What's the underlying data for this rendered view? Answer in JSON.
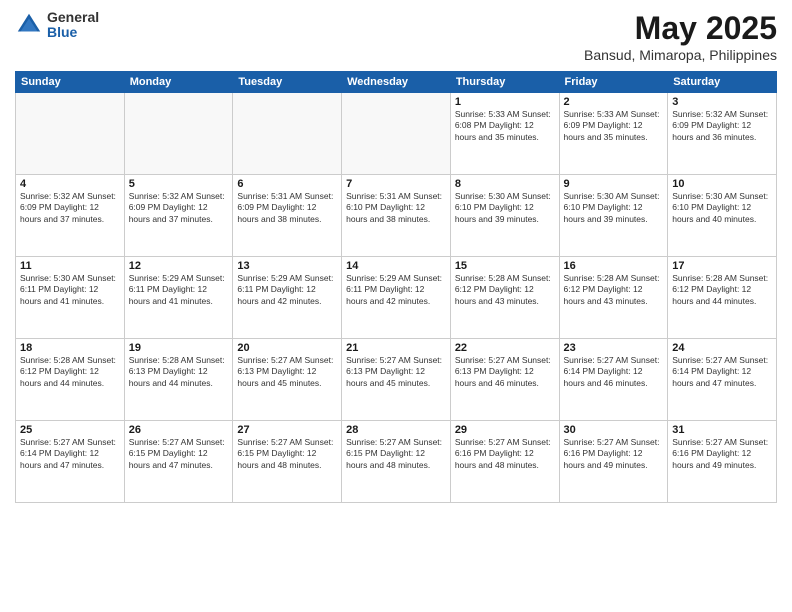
{
  "header": {
    "logo_general": "General",
    "logo_blue": "Blue",
    "title": "May 2025",
    "subtitle": "Bansud, Mimaropa, Philippines"
  },
  "days_of_week": [
    "Sunday",
    "Monday",
    "Tuesday",
    "Wednesday",
    "Thursday",
    "Friday",
    "Saturday"
  ],
  "weeks": [
    [
      {
        "day": "",
        "info": ""
      },
      {
        "day": "",
        "info": ""
      },
      {
        "day": "",
        "info": ""
      },
      {
        "day": "",
        "info": ""
      },
      {
        "day": "1",
        "info": "Sunrise: 5:33 AM\nSunset: 6:08 PM\nDaylight: 12 hours\nand 35 minutes."
      },
      {
        "day": "2",
        "info": "Sunrise: 5:33 AM\nSunset: 6:09 PM\nDaylight: 12 hours\nand 35 minutes."
      },
      {
        "day": "3",
        "info": "Sunrise: 5:32 AM\nSunset: 6:09 PM\nDaylight: 12 hours\nand 36 minutes."
      }
    ],
    [
      {
        "day": "4",
        "info": "Sunrise: 5:32 AM\nSunset: 6:09 PM\nDaylight: 12 hours\nand 37 minutes."
      },
      {
        "day": "5",
        "info": "Sunrise: 5:32 AM\nSunset: 6:09 PM\nDaylight: 12 hours\nand 37 minutes."
      },
      {
        "day": "6",
        "info": "Sunrise: 5:31 AM\nSunset: 6:09 PM\nDaylight: 12 hours\nand 38 minutes."
      },
      {
        "day": "7",
        "info": "Sunrise: 5:31 AM\nSunset: 6:10 PM\nDaylight: 12 hours\nand 38 minutes."
      },
      {
        "day": "8",
        "info": "Sunrise: 5:30 AM\nSunset: 6:10 PM\nDaylight: 12 hours\nand 39 minutes."
      },
      {
        "day": "9",
        "info": "Sunrise: 5:30 AM\nSunset: 6:10 PM\nDaylight: 12 hours\nand 39 minutes."
      },
      {
        "day": "10",
        "info": "Sunrise: 5:30 AM\nSunset: 6:10 PM\nDaylight: 12 hours\nand 40 minutes."
      }
    ],
    [
      {
        "day": "11",
        "info": "Sunrise: 5:30 AM\nSunset: 6:11 PM\nDaylight: 12 hours\nand 41 minutes."
      },
      {
        "day": "12",
        "info": "Sunrise: 5:29 AM\nSunset: 6:11 PM\nDaylight: 12 hours\nand 41 minutes."
      },
      {
        "day": "13",
        "info": "Sunrise: 5:29 AM\nSunset: 6:11 PM\nDaylight: 12 hours\nand 42 minutes."
      },
      {
        "day": "14",
        "info": "Sunrise: 5:29 AM\nSunset: 6:11 PM\nDaylight: 12 hours\nand 42 minutes."
      },
      {
        "day": "15",
        "info": "Sunrise: 5:28 AM\nSunset: 6:12 PM\nDaylight: 12 hours\nand 43 minutes."
      },
      {
        "day": "16",
        "info": "Sunrise: 5:28 AM\nSunset: 6:12 PM\nDaylight: 12 hours\nand 43 minutes."
      },
      {
        "day": "17",
        "info": "Sunrise: 5:28 AM\nSunset: 6:12 PM\nDaylight: 12 hours\nand 44 minutes."
      }
    ],
    [
      {
        "day": "18",
        "info": "Sunrise: 5:28 AM\nSunset: 6:12 PM\nDaylight: 12 hours\nand 44 minutes."
      },
      {
        "day": "19",
        "info": "Sunrise: 5:28 AM\nSunset: 6:13 PM\nDaylight: 12 hours\nand 44 minutes."
      },
      {
        "day": "20",
        "info": "Sunrise: 5:27 AM\nSunset: 6:13 PM\nDaylight: 12 hours\nand 45 minutes."
      },
      {
        "day": "21",
        "info": "Sunrise: 5:27 AM\nSunset: 6:13 PM\nDaylight: 12 hours\nand 45 minutes."
      },
      {
        "day": "22",
        "info": "Sunrise: 5:27 AM\nSunset: 6:13 PM\nDaylight: 12 hours\nand 46 minutes."
      },
      {
        "day": "23",
        "info": "Sunrise: 5:27 AM\nSunset: 6:14 PM\nDaylight: 12 hours\nand 46 minutes."
      },
      {
        "day": "24",
        "info": "Sunrise: 5:27 AM\nSunset: 6:14 PM\nDaylight: 12 hours\nand 47 minutes."
      }
    ],
    [
      {
        "day": "25",
        "info": "Sunrise: 5:27 AM\nSunset: 6:14 PM\nDaylight: 12 hours\nand 47 minutes."
      },
      {
        "day": "26",
        "info": "Sunrise: 5:27 AM\nSunset: 6:15 PM\nDaylight: 12 hours\nand 47 minutes."
      },
      {
        "day": "27",
        "info": "Sunrise: 5:27 AM\nSunset: 6:15 PM\nDaylight: 12 hours\nand 48 minutes."
      },
      {
        "day": "28",
        "info": "Sunrise: 5:27 AM\nSunset: 6:15 PM\nDaylight: 12 hours\nand 48 minutes."
      },
      {
        "day": "29",
        "info": "Sunrise: 5:27 AM\nSunset: 6:16 PM\nDaylight: 12 hours\nand 48 minutes."
      },
      {
        "day": "30",
        "info": "Sunrise: 5:27 AM\nSunset: 6:16 PM\nDaylight: 12 hours\nand 49 minutes."
      },
      {
        "day": "31",
        "info": "Sunrise: 5:27 AM\nSunset: 6:16 PM\nDaylight: 12 hours\nand 49 minutes."
      }
    ]
  ]
}
